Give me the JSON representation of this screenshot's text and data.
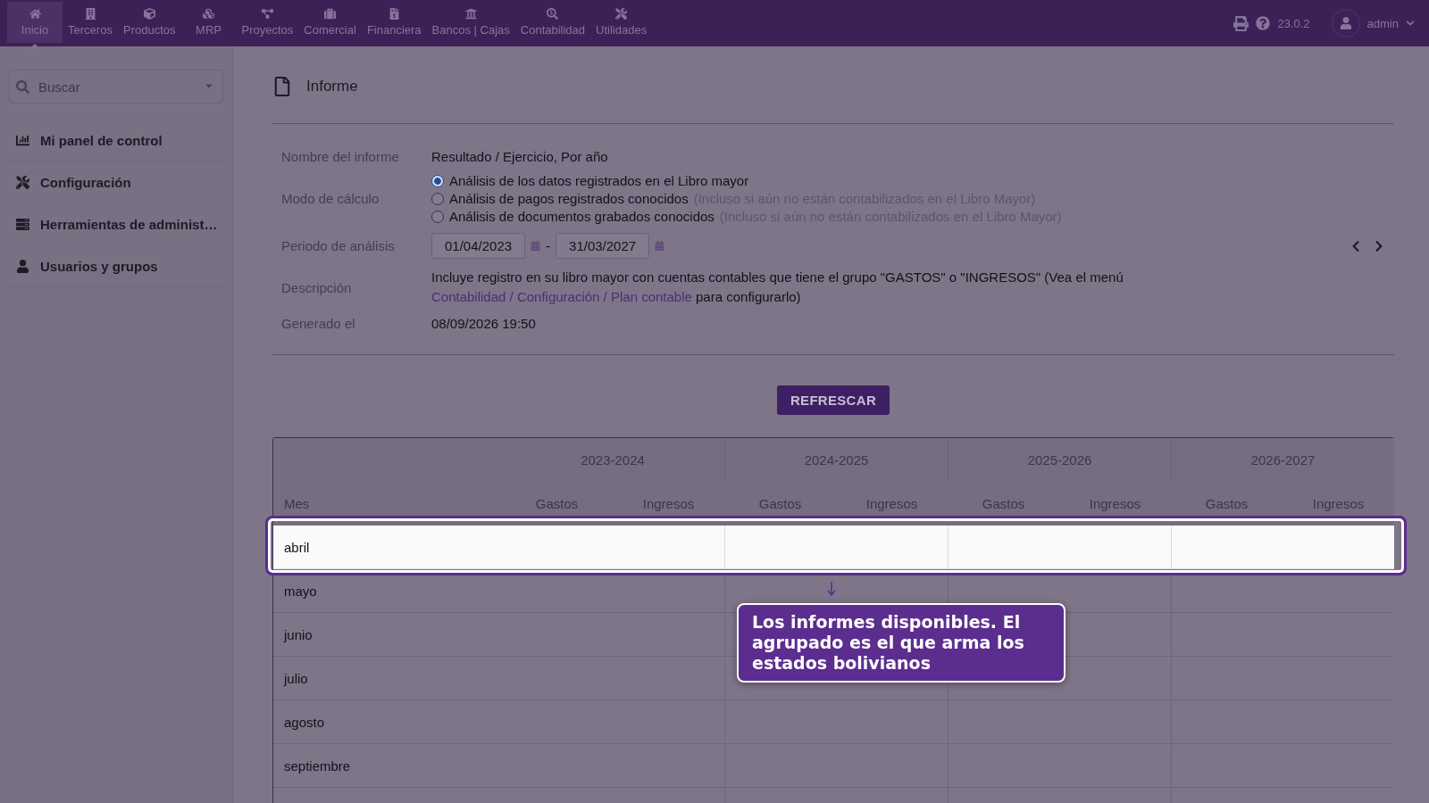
{
  "topbar": {
    "menu": [
      {
        "label": "Inicio",
        "selected": true
      },
      {
        "label": "Terceros",
        "selected": false
      },
      {
        "label": "Productos",
        "selected": false
      },
      {
        "label": "MRP",
        "selected": false
      },
      {
        "label": "Proyectos",
        "selected": false
      },
      {
        "label": "Comercial",
        "selected": false
      },
      {
        "label": "Financiera",
        "selected": false
      },
      {
        "label": "Bancos | Cajas",
        "selected": false
      },
      {
        "label": "Contabilidad",
        "selected": false
      },
      {
        "label": "Utilidades",
        "selected": false
      }
    ],
    "version": "23.0.2",
    "user": "admin"
  },
  "sidebar": {
    "search": {
      "placeholder": "Buscar"
    },
    "items": [
      {
        "label": "Mi panel de control"
      },
      {
        "label": "Configuración"
      },
      {
        "label": "Herramientas de administ…"
      },
      {
        "label": "Usuarios y grupos"
      }
    ]
  },
  "page": {
    "title": "Informe",
    "fields": {
      "name_label": "Nombre del informe",
      "name": "Resultado / Ejercicio, Por año",
      "mode_label": "Modo de cálculo",
      "modes": [
        {
          "text": "Análisis de los datos registrados en el Libro mayor",
          "selected": true
        },
        {
          "text": "Análisis de pagos registrados conocidos",
          "note": "(Incluso si aún no están contabilizados en el Libro Mayor)",
          "selected": false
        },
        {
          "text": "Análisis de documentos grabados conocidos",
          "note": "(Incluso si aún no están contabilizados en el Libro Mayor)",
          "selected": false
        }
      ],
      "period_label": "Periodo de análisis",
      "date_from": "01/04/2023",
      "date_sep": "-",
      "date_to": "31/03/2027",
      "description_label": "Descripción",
      "description_before": "Incluye registro en su libro mayor con cuentas contables que tiene el grupo \"GASTOS\" o \"INGRESOS\" (Vea el menú",
      "description_link": "Contabilidad / Configuración / Plan contable",
      "description_after": "para configurarlo)",
      "generated_label": "Generado el",
      "generated": "08/09/2026 19:50"
    },
    "refresh_button": "REFRESCAR",
    "table": {
      "years": [
        {
          "label": "2023-2024",
          "sub_columns": [
            "Gastos",
            "Ingresos"
          ]
        },
        {
          "label": "2024-2025",
          "sub_columns": [
            "Gastos",
            "Ingresos"
          ]
        },
        {
          "label": "2025-2026",
          "sub_columns": [
            "Gastos",
            "Ingresos"
          ]
        },
        {
          "label": "2026-2027",
          "sub_columns": [
            "Gastos",
            "Ingresos"
          ]
        }
      ],
      "month_header": "Mes",
      "rows": [
        {
          "month": "abril",
          "highlighted": true
        },
        {
          "month": "mayo",
          "highlighted": false
        },
        {
          "month": "junio",
          "highlighted": false
        },
        {
          "month": "julio",
          "highlighted": false
        },
        {
          "month": "agosto",
          "highlighted": false
        },
        {
          "month": "septiembre",
          "highlighted": false
        }
      ]
    }
  },
  "tour": {
    "text": "Los informes disponibles. El agrupado es el que arma los estados bolivianos"
  }
}
